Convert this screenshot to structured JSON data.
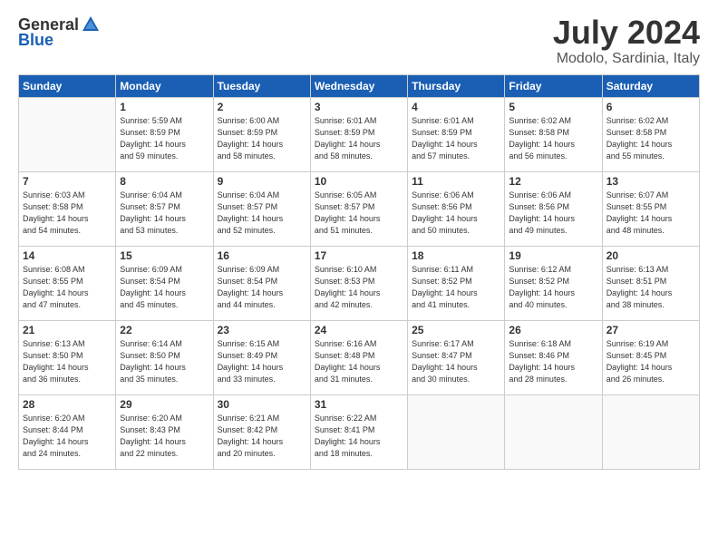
{
  "header": {
    "logo_general": "General",
    "logo_blue": "Blue",
    "title": "July 2024",
    "location": "Modolo, Sardinia, Italy"
  },
  "weekdays": [
    "Sunday",
    "Monday",
    "Tuesday",
    "Wednesday",
    "Thursday",
    "Friday",
    "Saturday"
  ],
  "weeks": [
    [
      {
        "day": "",
        "info": ""
      },
      {
        "day": "1",
        "info": "Sunrise: 5:59 AM\nSunset: 8:59 PM\nDaylight: 14 hours\nand 59 minutes."
      },
      {
        "day": "2",
        "info": "Sunrise: 6:00 AM\nSunset: 8:59 PM\nDaylight: 14 hours\nand 58 minutes."
      },
      {
        "day": "3",
        "info": "Sunrise: 6:01 AM\nSunset: 8:59 PM\nDaylight: 14 hours\nand 58 minutes."
      },
      {
        "day": "4",
        "info": "Sunrise: 6:01 AM\nSunset: 8:59 PM\nDaylight: 14 hours\nand 57 minutes."
      },
      {
        "day": "5",
        "info": "Sunrise: 6:02 AM\nSunset: 8:58 PM\nDaylight: 14 hours\nand 56 minutes."
      },
      {
        "day": "6",
        "info": "Sunrise: 6:02 AM\nSunset: 8:58 PM\nDaylight: 14 hours\nand 55 minutes."
      }
    ],
    [
      {
        "day": "7",
        "info": "Sunrise: 6:03 AM\nSunset: 8:58 PM\nDaylight: 14 hours\nand 54 minutes."
      },
      {
        "day": "8",
        "info": "Sunrise: 6:04 AM\nSunset: 8:57 PM\nDaylight: 14 hours\nand 53 minutes."
      },
      {
        "day": "9",
        "info": "Sunrise: 6:04 AM\nSunset: 8:57 PM\nDaylight: 14 hours\nand 52 minutes."
      },
      {
        "day": "10",
        "info": "Sunrise: 6:05 AM\nSunset: 8:57 PM\nDaylight: 14 hours\nand 51 minutes."
      },
      {
        "day": "11",
        "info": "Sunrise: 6:06 AM\nSunset: 8:56 PM\nDaylight: 14 hours\nand 50 minutes."
      },
      {
        "day": "12",
        "info": "Sunrise: 6:06 AM\nSunset: 8:56 PM\nDaylight: 14 hours\nand 49 minutes."
      },
      {
        "day": "13",
        "info": "Sunrise: 6:07 AM\nSunset: 8:55 PM\nDaylight: 14 hours\nand 48 minutes."
      }
    ],
    [
      {
        "day": "14",
        "info": "Sunrise: 6:08 AM\nSunset: 8:55 PM\nDaylight: 14 hours\nand 47 minutes."
      },
      {
        "day": "15",
        "info": "Sunrise: 6:09 AM\nSunset: 8:54 PM\nDaylight: 14 hours\nand 45 minutes."
      },
      {
        "day": "16",
        "info": "Sunrise: 6:09 AM\nSunset: 8:54 PM\nDaylight: 14 hours\nand 44 minutes."
      },
      {
        "day": "17",
        "info": "Sunrise: 6:10 AM\nSunset: 8:53 PM\nDaylight: 14 hours\nand 42 minutes."
      },
      {
        "day": "18",
        "info": "Sunrise: 6:11 AM\nSunset: 8:52 PM\nDaylight: 14 hours\nand 41 minutes."
      },
      {
        "day": "19",
        "info": "Sunrise: 6:12 AM\nSunset: 8:52 PM\nDaylight: 14 hours\nand 40 minutes."
      },
      {
        "day": "20",
        "info": "Sunrise: 6:13 AM\nSunset: 8:51 PM\nDaylight: 14 hours\nand 38 minutes."
      }
    ],
    [
      {
        "day": "21",
        "info": "Sunrise: 6:13 AM\nSunset: 8:50 PM\nDaylight: 14 hours\nand 36 minutes."
      },
      {
        "day": "22",
        "info": "Sunrise: 6:14 AM\nSunset: 8:50 PM\nDaylight: 14 hours\nand 35 minutes."
      },
      {
        "day": "23",
        "info": "Sunrise: 6:15 AM\nSunset: 8:49 PM\nDaylight: 14 hours\nand 33 minutes."
      },
      {
        "day": "24",
        "info": "Sunrise: 6:16 AM\nSunset: 8:48 PM\nDaylight: 14 hours\nand 31 minutes."
      },
      {
        "day": "25",
        "info": "Sunrise: 6:17 AM\nSunset: 8:47 PM\nDaylight: 14 hours\nand 30 minutes."
      },
      {
        "day": "26",
        "info": "Sunrise: 6:18 AM\nSunset: 8:46 PM\nDaylight: 14 hours\nand 28 minutes."
      },
      {
        "day": "27",
        "info": "Sunrise: 6:19 AM\nSunset: 8:45 PM\nDaylight: 14 hours\nand 26 minutes."
      }
    ],
    [
      {
        "day": "28",
        "info": "Sunrise: 6:20 AM\nSunset: 8:44 PM\nDaylight: 14 hours\nand 24 minutes."
      },
      {
        "day": "29",
        "info": "Sunrise: 6:20 AM\nSunset: 8:43 PM\nDaylight: 14 hours\nand 22 minutes."
      },
      {
        "day": "30",
        "info": "Sunrise: 6:21 AM\nSunset: 8:42 PM\nDaylight: 14 hours\nand 20 minutes."
      },
      {
        "day": "31",
        "info": "Sunrise: 6:22 AM\nSunset: 8:41 PM\nDaylight: 14 hours\nand 18 minutes."
      },
      {
        "day": "",
        "info": ""
      },
      {
        "day": "",
        "info": ""
      },
      {
        "day": "",
        "info": ""
      }
    ]
  ]
}
